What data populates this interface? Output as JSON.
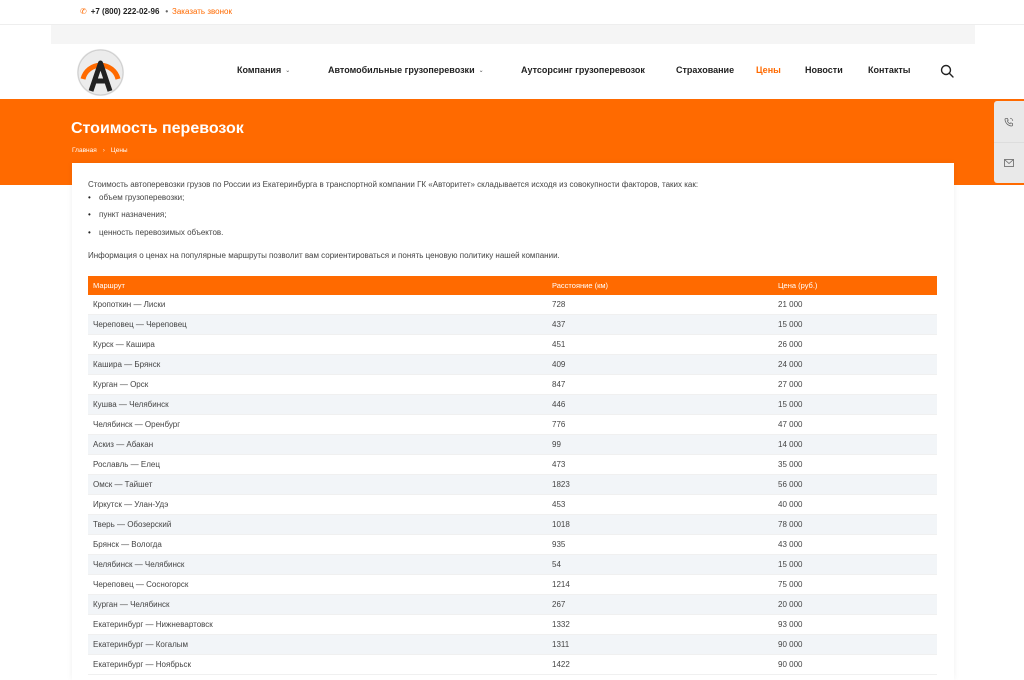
{
  "topbar": {
    "phone": "+7 (800) 222-02-96",
    "callback": "Заказать звонок"
  },
  "nav": {
    "items": [
      {
        "label": "Компания",
        "has_menu": true
      },
      {
        "label": "Автомобильные грузоперевозки",
        "has_menu": true
      },
      {
        "label": "Аутсорсинг грузоперевозок",
        "has_menu": false
      },
      {
        "label": "Страхование",
        "has_menu": false
      },
      {
        "label": "Цены",
        "has_menu": false,
        "active": true
      },
      {
        "label": "Новости",
        "has_menu": false
      },
      {
        "label": "Контакты",
        "has_menu": false
      }
    ]
  },
  "hero": {
    "title": "Стоимость перевозок",
    "breadcrumb": [
      "Главная",
      "Цены"
    ]
  },
  "content": {
    "intro": "Стоимость автоперевозки грузов по России из Екатеринбурга в транспортной компании ГК «Авторитет» складывается исходя из совокупности факторов, таких как:",
    "bullets": [
      "объем грузоперевозки;",
      "пункт назначения;",
      "ценность перевозимых объектов."
    ],
    "info": "Информация о ценах на популярные маршруты позволит вам сориентироваться и понять ценовую политику нашей компании."
  },
  "table": {
    "headers": [
      "Маршрут",
      "Расстояние (км)",
      "Цена (руб.)"
    ],
    "rows": [
      [
        "Кропоткин — Лиски",
        "728",
        "21 000"
      ],
      [
        "Череповец — Череповец",
        "437",
        "15 000"
      ],
      [
        "Курск — Кашира",
        "451",
        "26 000"
      ],
      [
        "Кашира — Брянск",
        "409",
        "24 000"
      ],
      [
        "Курган — Орск",
        "847",
        "27 000"
      ],
      [
        "Кушва — Челябинск",
        "446",
        "15 000"
      ],
      [
        "Челябинск — Оренбург",
        "776",
        "47 000"
      ],
      [
        "Аскиз — Абакан",
        "99",
        "14 000"
      ],
      [
        "Рославль — Елец",
        "473",
        "35 000"
      ],
      [
        "Омск — Тайшет",
        "1823",
        "56 000"
      ],
      [
        "Иркутск — Улан-Удэ",
        "453",
        "40 000"
      ],
      [
        "Тверь — Обозерский",
        "1018",
        "78 000"
      ],
      [
        "Брянск — Вологда",
        "935",
        "43 000"
      ],
      [
        "Челябинск — Челябинск",
        "54",
        "15 000"
      ],
      [
        "Череповец — Сосногорск",
        "1214",
        "75 000"
      ],
      [
        "Курган — Челябинск",
        "267",
        "20 000"
      ],
      [
        "Екатеринбург — Нижневартовск",
        "1332",
        "93 000"
      ],
      [
        "Екатеринбург — Когалым",
        "1311",
        "90 000"
      ],
      [
        "Екатеринбург — Ноябрьск",
        "1422",
        "90 000"
      ]
    ]
  },
  "colors": {
    "accent": "#ff6a00"
  },
  "icons": {
    "phone": "phone-icon",
    "search": "search-icon",
    "callback_widget": "phone-call-icon",
    "mail_widget": "mail-icon"
  }
}
